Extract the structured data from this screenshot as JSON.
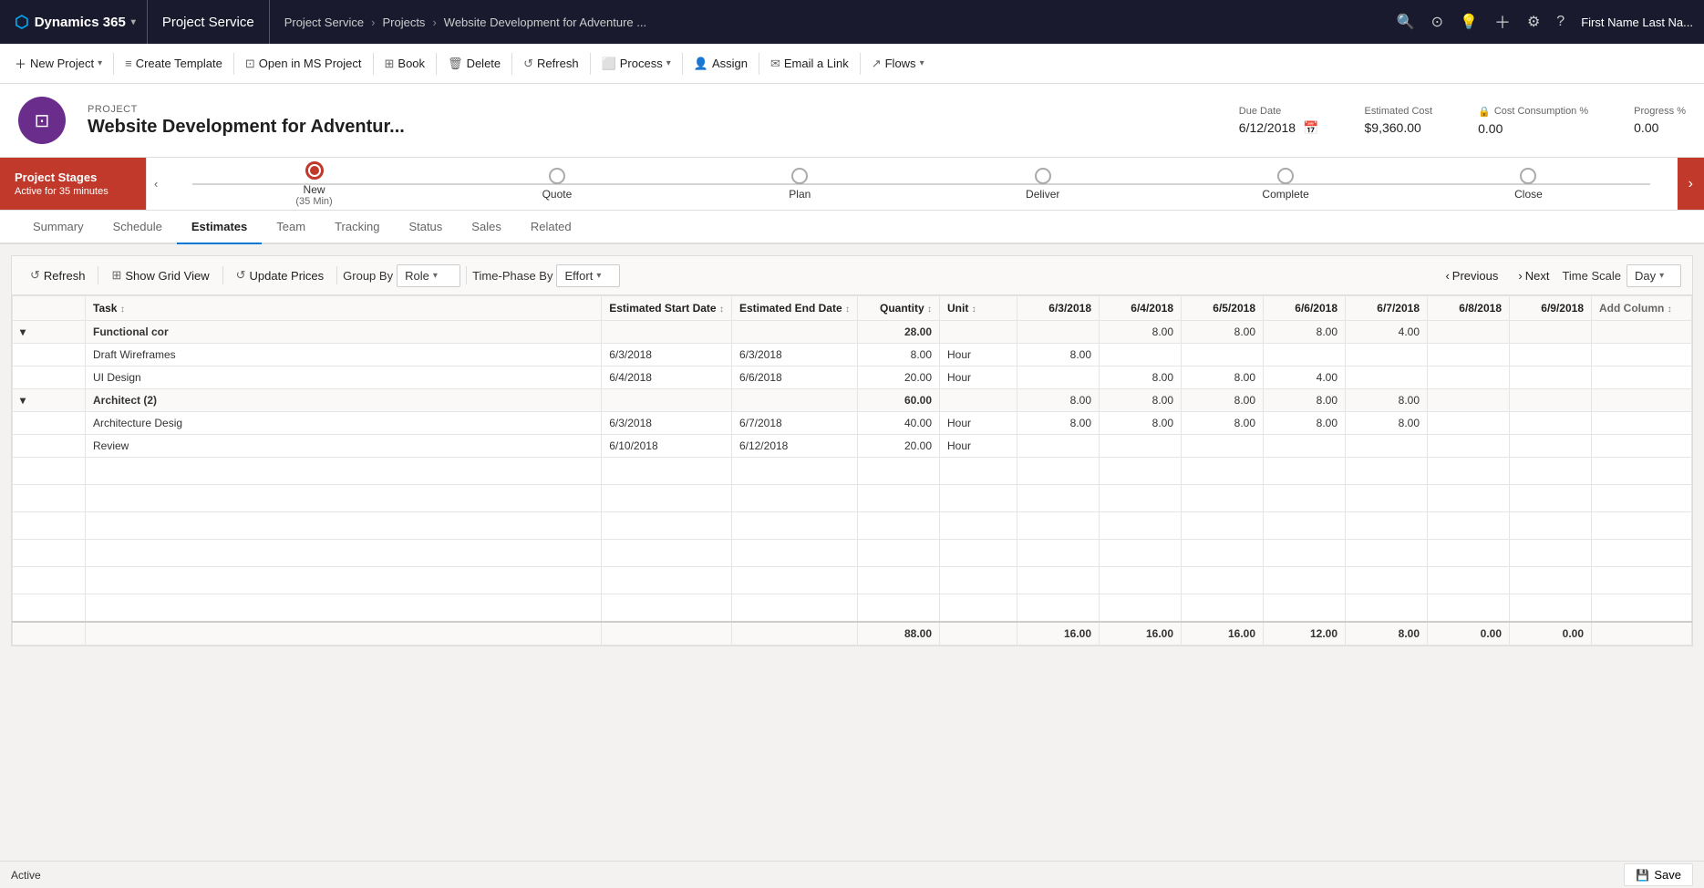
{
  "topnav": {
    "dynamics365": "Dynamics 365",
    "app": "Project Service",
    "breadcrumb": [
      "Project Service",
      "Projects",
      "Website Development for Adventure ..."
    ],
    "user": "First Name Last Na..."
  },
  "commandbar": {
    "buttons": [
      {
        "id": "new-project",
        "label": "New Project",
        "icon": "＋",
        "dropdown": true
      },
      {
        "id": "create-template",
        "label": "Create Template",
        "icon": "📄"
      },
      {
        "id": "open-ms-project",
        "label": "Open in MS Project",
        "icon": "📁"
      },
      {
        "id": "book",
        "label": "Book",
        "icon": "⊞"
      },
      {
        "id": "delete",
        "label": "Delete",
        "icon": "🗑"
      },
      {
        "id": "refresh",
        "label": "Refresh",
        "icon": "↺"
      },
      {
        "id": "process",
        "label": "Process",
        "icon": "⬜",
        "dropdown": true
      },
      {
        "id": "assign",
        "label": "Assign",
        "icon": "👤"
      },
      {
        "id": "email-link",
        "label": "Email a Link",
        "icon": "✉"
      },
      {
        "id": "flows",
        "label": "Flows",
        "icon": "↗",
        "dropdown": true
      }
    ]
  },
  "project": {
    "label": "PROJECT",
    "title": "Website Development for Adventur...",
    "icon": "⊡",
    "dueDate": {
      "label": "Due Date",
      "value": "6/12/2018"
    },
    "estimatedCost": {
      "label": "Estimated Cost",
      "value": "$9,360.00"
    },
    "costConsumption": {
      "label": "Cost Consumption %",
      "value": "0.00"
    },
    "progress": {
      "label": "Progress %",
      "value": "0.00"
    }
  },
  "stages": {
    "label": "Project Stages",
    "sublabel": "Active for 35 minutes",
    "steps": [
      {
        "id": "new",
        "label": "New",
        "sublabel": "(35 Min)",
        "active": true
      },
      {
        "id": "quote",
        "label": "Quote",
        "active": false
      },
      {
        "id": "plan",
        "label": "Plan",
        "active": false
      },
      {
        "id": "deliver",
        "label": "Deliver",
        "active": false
      },
      {
        "id": "complete",
        "label": "Complete",
        "active": false
      },
      {
        "id": "close",
        "label": "Close",
        "active": false
      }
    ]
  },
  "tabs": [
    {
      "id": "summary",
      "label": "Summary",
      "active": false
    },
    {
      "id": "schedule",
      "label": "Schedule",
      "active": false
    },
    {
      "id": "estimates",
      "label": "Estimates",
      "active": true
    },
    {
      "id": "team",
      "label": "Team",
      "active": false
    },
    {
      "id": "tracking",
      "label": "Tracking",
      "active": false
    },
    {
      "id": "status",
      "label": "Status",
      "active": false
    },
    {
      "id": "sales",
      "label": "Sales",
      "active": false
    },
    {
      "id": "related",
      "label": "Related",
      "active": false
    }
  ],
  "estimates": {
    "toolbar": {
      "refresh": "Refresh",
      "showGridView": "Show Grid View",
      "updatePrices": "Update Prices",
      "groupByLabel": "Group By",
      "groupByValue": "Role",
      "timephaseLabel": "Time-Phase By",
      "timephaseValue": "Effort",
      "previous": "Previous",
      "next": "Next",
      "timescaleLabel": "Time Scale",
      "timescaleValue": "Day"
    },
    "columns": {
      "fixed": "",
      "task": "Task",
      "startDate": "Estimated Start Date",
      "endDate": "Estimated End Date",
      "quantity": "Quantity",
      "unit": "Unit",
      "dates": [
        "6/3/2018",
        "6/4/2018",
        "6/5/2018",
        "6/6/2018",
        "6/7/2018",
        "6/8/2018",
        "6/9/2018"
      ],
      "addColumn": "Add Column"
    },
    "rows": [
      {
        "type": "group",
        "label": "Functional cor",
        "quantity": "28.00",
        "unit": "",
        "dateValues": [
          "",
          "8.00",
          "8.00",
          "8.00",
          "4.00",
          "",
          ""
        ]
      },
      {
        "type": "data",
        "task": "Draft Wireframes",
        "startDate": "6/3/2018",
        "endDate": "6/3/2018",
        "quantity": "8.00",
        "unit": "Hour",
        "dateValues": [
          "8.00",
          "",
          "",
          "",
          "",
          "",
          ""
        ]
      },
      {
        "type": "data",
        "task": "UI Design",
        "startDate": "6/4/2018",
        "endDate": "6/6/2018",
        "quantity": "20.00",
        "unit": "Hour",
        "dateValues": [
          "",
          "8.00",
          "8.00",
          "4.00",
          "",
          "",
          ""
        ]
      },
      {
        "type": "group",
        "label": "Architect (2)",
        "quantity": "60.00",
        "unit": "",
        "dateValues": [
          "8.00",
          "8.00",
          "8.00",
          "8.00",
          "8.00",
          "",
          ""
        ]
      },
      {
        "type": "data",
        "task": "Architecture Desig",
        "startDate": "6/3/2018",
        "endDate": "6/7/2018",
        "quantity": "40.00",
        "unit": "Hour",
        "dateValues": [
          "8.00",
          "8.00",
          "8.00",
          "8.00",
          "8.00",
          "",
          ""
        ]
      },
      {
        "type": "data",
        "task": "Review",
        "startDate": "6/10/2018",
        "endDate": "6/12/2018",
        "quantity": "20.00",
        "unit": "Hour",
        "dateValues": [
          "",
          "",
          "",
          "",
          "",
          "",
          ""
        ]
      }
    ],
    "totals": {
      "quantity": "88.00",
      "dateValues": [
        "16.00",
        "16.00",
        "16.00",
        "12.00",
        "8.00",
        "0.00",
        "0.00"
      ]
    }
  },
  "statusbar": {
    "status": "Active",
    "save": "Save"
  }
}
